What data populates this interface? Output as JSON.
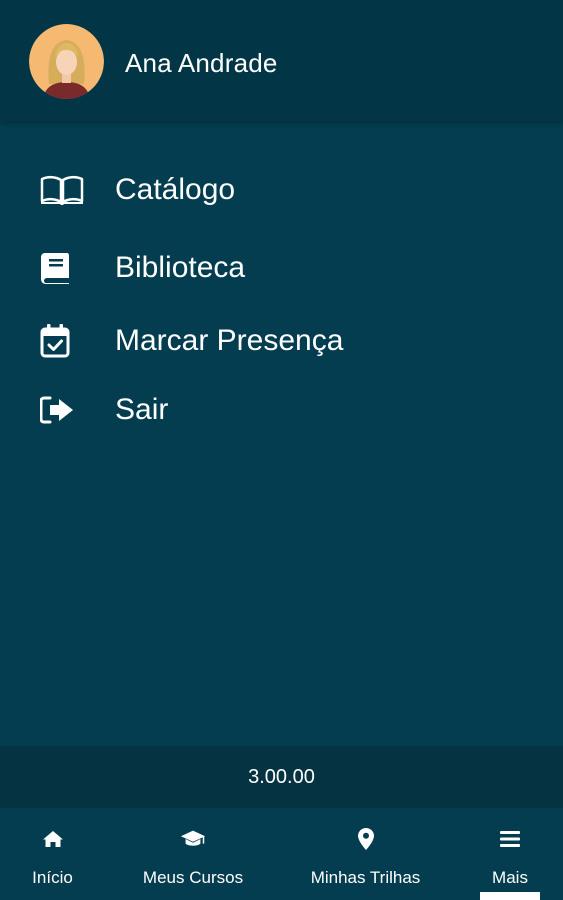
{
  "header": {
    "user_name": "Ana Andrade",
    "avatar_icon": "user-avatar"
  },
  "menu": {
    "items": [
      {
        "label": "Catálogo",
        "icon": "open-book-icon"
      },
      {
        "label": "Biblioteca",
        "icon": "book-icon"
      },
      {
        "label": "Marcar Presença",
        "icon": "calendar-check-icon"
      },
      {
        "label": "Sair",
        "icon": "sign-out-icon"
      }
    ]
  },
  "footer": {
    "version": "3.00.00"
  },
  "bottom_nav": {
    "items": [
      {
        "label": "Início",
        "icon": "home-icon"
      },
      {
        "label": "Meus Cursos",
        "icon": "graduation-cap-icon"
      },
      {
        "label": "Minhas Trilhas",
        "icon": "map-marker-icon"
      },
      {
        "label": "Mais",
        "icon": "menu-bars-icon",
        "active": true
      }
    ]
  },
  "colors": {
    "background": "#033d4f",
    "header": "#023646",
    "version_bar": "#053341",
    "text": "#ffffff"
  }
}
